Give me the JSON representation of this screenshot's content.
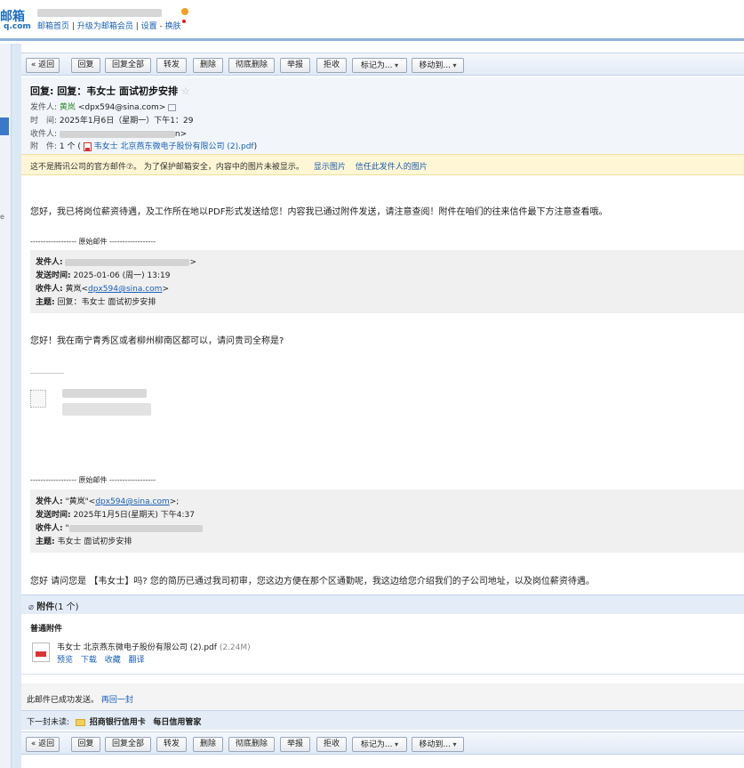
{
  "header": {
    "logo_top": "邮箱",
    "logo_bottom": "q.com",
    "links": {
      "home": "邮箱首页",
      "upgrade": "升级为邮箱会员",
      "settings": "设置",
      "skin": "换肤"
    },
    "sep": "|"
  },
  "left": {
    "edge_char": "e"
  },
  "toolbar": {
    "back": "« 返回",
    "reply": "回复",
    "reply_all": "回复全部",
    "forward": "转发",
    "delete": "删除",
    "perm_delete": "彻底删除",
    "report": "举报",
    "reject": "拒收",
    "mark_as": "标记为...",
    "move_to": "移动到..."
  },
  "mail": {
    "subject": "回复: 回复：韦女士 面试初步安排",
    "star": "☆",
    "from_label": "发件人:",
    "from_name": "黄岚",
    "from_email": "<dpx594@sina.com>",
    "time_label": "时　间:",
    "time_value": "2025年1月6日（星期一）下午1：29",
    "to_label": "收件人:",
    "to_value": "n>",
    "attach_label": "附　件:",
    "attach_count": "1 个",
    "attach_open": "(",
    "attach_file": "韦女士 北京燕东微电子股份有限公司 (2).pdf",
    "attach_close": ")"
  },
  "warning": {
    "text": "这不是腾讯公司的官方邮件⑦。 为了保护邮箱安全，内容中的图片未被显示。",
    "show_images": "显示图片",
    "trust_sender": "信任此发件人的图片"
  },
  "body": {
    "para1": "您好，我已将岗位薪资待遇，及工作所在地以PDF形式发送给您！内容我已通过附件发送，请注意查阅！附件在咱们的往来信件最下方注意查看哦。",
    "divider": "------------------ 原始邮件 ------------------",
    "quote1": {
      "from_label": "发件人:",
      "from_value": ">",
      "sent_label": "发送时间:",
      "sent_value": "2025-01-06 (周一) 13:19",
      "to_label": "收件人:",
      "to_name": "黄岚<",
      "to_email": "dpx594@sina.com",
      "to_end": ">",
      "subject_label": "主题:",
      "subject_value": "回复：韦女士 面试初步安排"
    },
    "para2": "您好！我在南宁青秀区或者柳州柳南区都可以，请问贵司全称是?",
    "divider2": "------------------ 原始邮件 ------------------",
    "quote2": {
      "from_label": "发件人:",
      "from_name": "\"黄岚\"<",
      "from_email": "dpx594@sina.com",
      "from_end": ">;",
      "sent_label": "发送时间:",
      "sent_value": "2025年1月5日(星期天) 下午4:37",
      "to_label": "收件人:",
      "to_value": "\"",
      "subject_label": "主题:",
      "subject_value": "韦女士 面试初步安排"
    },
    "para3": "您好 请问您是 【韦女士】吗? 您的简历已通过我司初审，您这边方便在那个区通勤呢，我这边给您介绍我们的子公司地址，以及岗位薪资待遇。"
  },
  "attachments": {
    "title": "附件",
    "count": "(1 个)",
    "category": "普通附件",
    "file_name": "韦女士 北京燕东微电子股份有限公司 (2).pdf",
    "file_size": "(2.24M)",
    "ops": {
      "preview": "预览",
      "download": "下载",
      "favorite": "收藏",
      "translate": "翻译"
    }
  },
  "footer": {
    "sent_note": "此邮件已成功发送。",
    "send_again": "再回一封",
    "next_label": "下一封未读:",
    "next_title": "招商银行信用卡",
    "next_subject": "每日信用管家"
  }
}
